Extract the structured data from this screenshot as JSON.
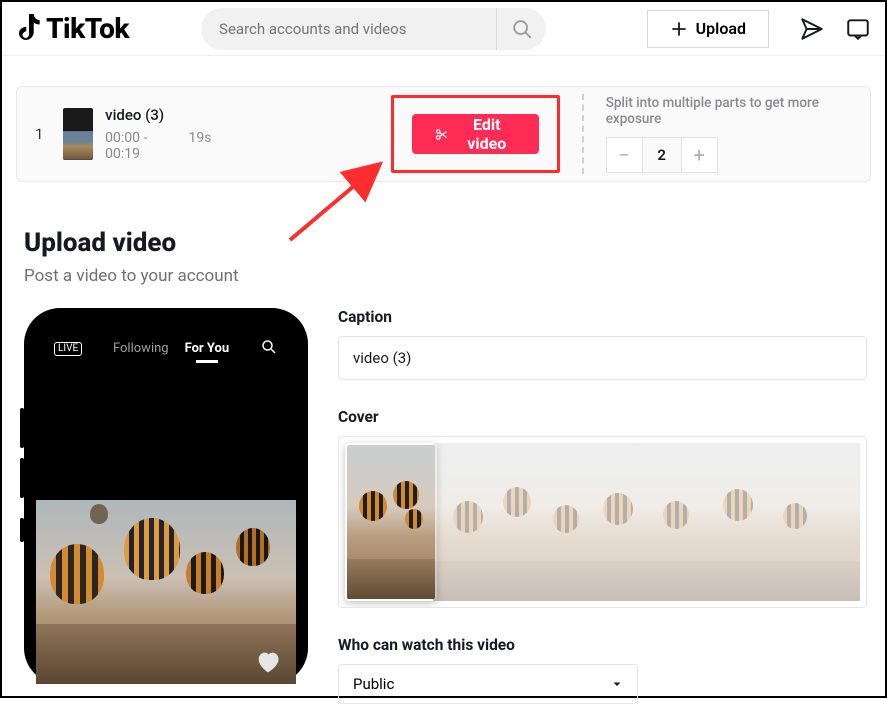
{
  "brand": "TikTok",
  "search": {
    "placeholder": "Search accounts and videos"
  },
  "upload_btn": "Upload",
  "clip": {
    "index": "1",
    "title": "video (3)",
    "range": "00:00 - 00:19",
    "duration": "19s",
    "edit_label": "Edit video",
    "split_hint": "Split into multiple parts to get more exposure",
    "split_count": "2"
  },
  "page": {
    "title": "Upload video",
    "subtitle": "Post a video to your account"
  },
  "phone": {
    "following": "Following",
    "for_you": "For You"
  },
  "form": {
    "caption_label": "Caption",
    "caption_value": "video (3)",
    "cover_label": "Cover",
    "privacy_label": "Who can watch this video",
    "privacy_value": "Public"
  }
}
